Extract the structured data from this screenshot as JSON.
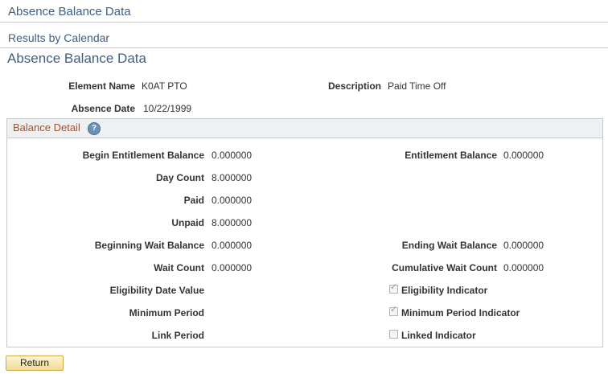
{
  "header": {
    "title": "Absence Balance Data",
    "subtitle": "Results by Calendar"
  },
  "page": {
    "title": "Absence Balance Data"
  },
  "summary": {
    "element_name": {
      "label": "Element Name",
      "value": "K0AT PTO"
    },
    "description": {
      "label": "Description",
      "value": "Paid Time Off"
    },
    "absence_date": {
      "label": "Absence Date",
      "value": "10/22/1999"
    }
  },
  "balance_detail": {
    "title": "Balance Detail",
    "help_icon": "?",
    "fields": {
      "begin_entitlement": {
        "label": "Begin Entitlement Balance",
        "value": "0.000000"
      },
      "entitlement": {
        "label": "Entitlement Balance",
        "value": "0.000000"
      },
      "day_count": {
        "label": "Day Count",
        "value": "8.000000"
      },
      "paid": {
        "label": "Paid",
        "value": "0.000000"
      },
      "unpaid": {
        "label": "Unpaid",
        "value": "8.000000"
      },
      "beginning_wait": {
        "label": "Beginning Wait Balance",
        "value": "0.000000"
      },
      "ending_wait": {
        "label": "Ending Wait Balance",
        "value": "0.000000"
      },
      "wait_count": {
        "label": "Wait Count",
        "value": "0.000000"
      },
      "cumulative_wait": {
        "label": "Cumulative Wait Count",
        "value": "0.000000"
      },
      "eligibility_date": {
        "label": "Eligibility Date Value",
        "value": ""
      },
      "minimum_period": {
        "label": "Minimum Period",
        "value": ""
      },
      "link_period": {
        "label": "Link Period",
        "value": ""
      }
    },
    "checkboxes": {
      "eligibility_indicator": {
        "label": "Eligibility Indicator",
        "checked": true
      },
      "minimum_period_indicator": {
        "label": "Minimum Period Indicator",
        "checked": true
      },
      "linked_indicator": {
        "label": "Linked Indicator",
        "checked": false
      }
    }
  },
  "actions": {
    "return_label": "Return"
  },
  "colors": {
    "header_text": "#3f5e82",
    "group_title": "#a0522d",
    "button_bg": "#f2dc95"
  }
}
